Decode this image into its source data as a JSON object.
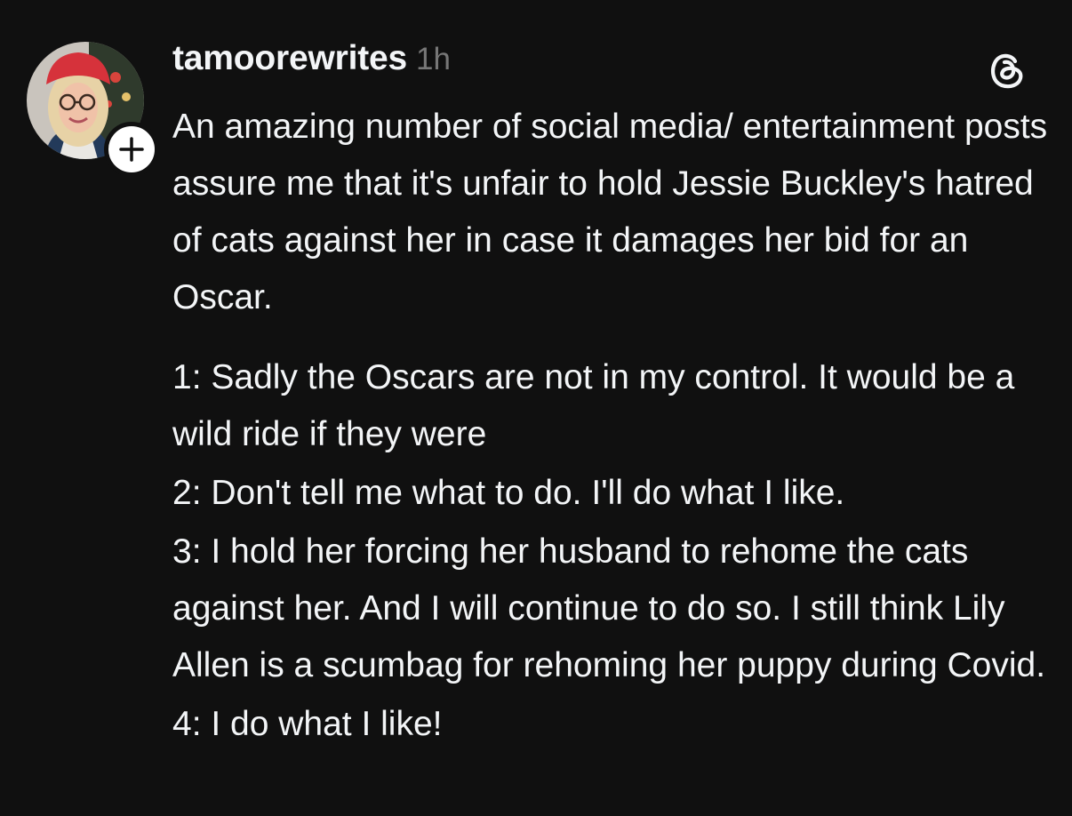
{
  "post": {
    "username": "tamoorewrites",
    "timestamp": "1h",
    "paragraphs": [
      "An amazing number of social media/ entertainment posts assure me that it's unfair to hold Jessie Buckley's hatred of cats against her in case it damages her bid for an Oscar.",
      "1: Sadly the Oscars are not in my control. It would be a wild ride if they were",
      "2: Don't tell me what to do. I'll do what I like.",
      "3: I hold her forcing her husband to rehome the cats against her. And I will continue to do so. I still think Lily Allen is a scumbag for rehoming her puppy during Covid.",
      "4: I do what I like!"
    ]
  },
  "icons": {
    "avatar": "profile-photo",
    "follow": "plus-icon",
    "app": "threads-logo-icon"
  },
  "colors": {
    "background": "#101010",
    "text": "#f3f5f7",
    "muted": "#777777",
    "badge": "#ffffff"
  }
}
